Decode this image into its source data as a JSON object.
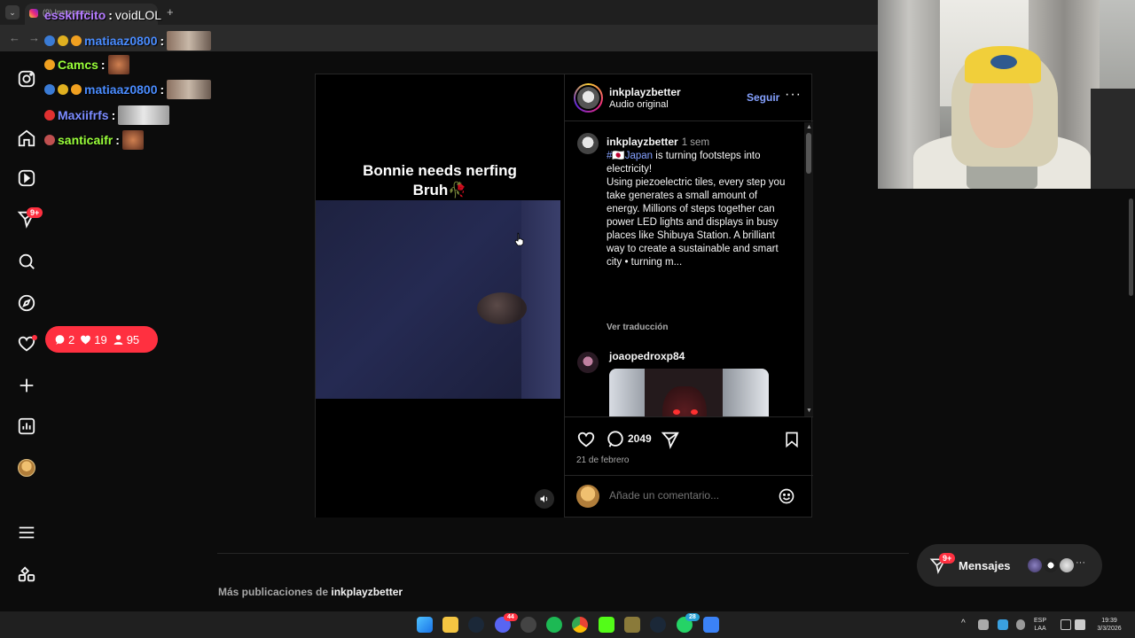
{
  "browser": {
    "tab_title": "(9) Instagram",
    "new_tab": "+",
    "tab_list": "⌄",
    "back": "←",
    "forward": "→"
  },
  "chat": {
    "messages": [
      {
        "user": "esskiffcito",
        "text": "voidLOL",
        "color": "#b47bff"
      },
      {
        "user": "matiaaz0800",
        "text": "",
        "color": "#4a8cff"
      },
      {
        "user": "Camcs",
        "text": "",
        "color": "#9aff3a"
      },
      {
        "user": "matiaaz0800",
        "text": "",
        "color": "#4a8cff"
      },
      {
        "user": "Maxiifrfs",
        "text": "",
        "color": "#7b8bff"
      },
      {
        "user": "santicaifr",
        "text": "",
        "color": "#9aff3a"
      }
    ]
  },
  "nav": {
    "notifications_badge": "9+",
    "icons": [
      "instagram-icon",
      "home-icon",
      "reels-icon",
      "messages-icon",
      "search-icon",
      "explore-icon",
      "heart-icon",
      "create-icon",
      "dashboard-icon",
      "profile-icon",
      "menu-icon",
      "threads-icon"
    ]
  },
  "notif_pill": {
    "comments": "2",
    "likes": "19",
    "follows": "95"
  },
  "post": {
    "video_caption_line1": "Bonnie needs nerfing",
    "video_caption_line2": "Bruh🥀",
    "author": "inkplayzbetter",
    "audio": "Audio original",
    "follow_label": "Seguir",
    "more": "···",
    "caption_time": "1 sem",
    "caption_hashtag": "#🇯🇵Japan",
    "caption_rest": " is turning footsteps into electricity!",
    "caption_body": "Using piezoelectric tiles, every step you take generates a small amount of energy. Millions of steps together can power LED lights and displays in busy places like Shibuya Station. A brilliant way to create a sustainable and smart city • turning m...",
    "translate": "Ver traducción",
    "commenter": "joaopedroxp84",
    "comment_count": "2049",
    "date": "21 de febrero",
    "comment_placeholder": "Añade un comentario..."
  },
  "more_posts": {
    "prefix": "Más publicaciones de ",
    "user": "inkplayzbetter"
  },
  "messages": {
    "label": "Mensajes",
    "badge": "9+",
    "more": "···"
  },
  "tray": {
    "lang_top": "ESP",
    "lang_bottom": "LAA",
    "time": "19:39",
    "date": "3/3/2026",
    "chevron": "^"
  },
  "taskbar": {
    "discord_badge": "44",
    "whatsapp_badge": "28"
  },
  "colors": {
    "accent_link": "#85a1ff",
    "notification_red": "#ff3040"
  }
}
